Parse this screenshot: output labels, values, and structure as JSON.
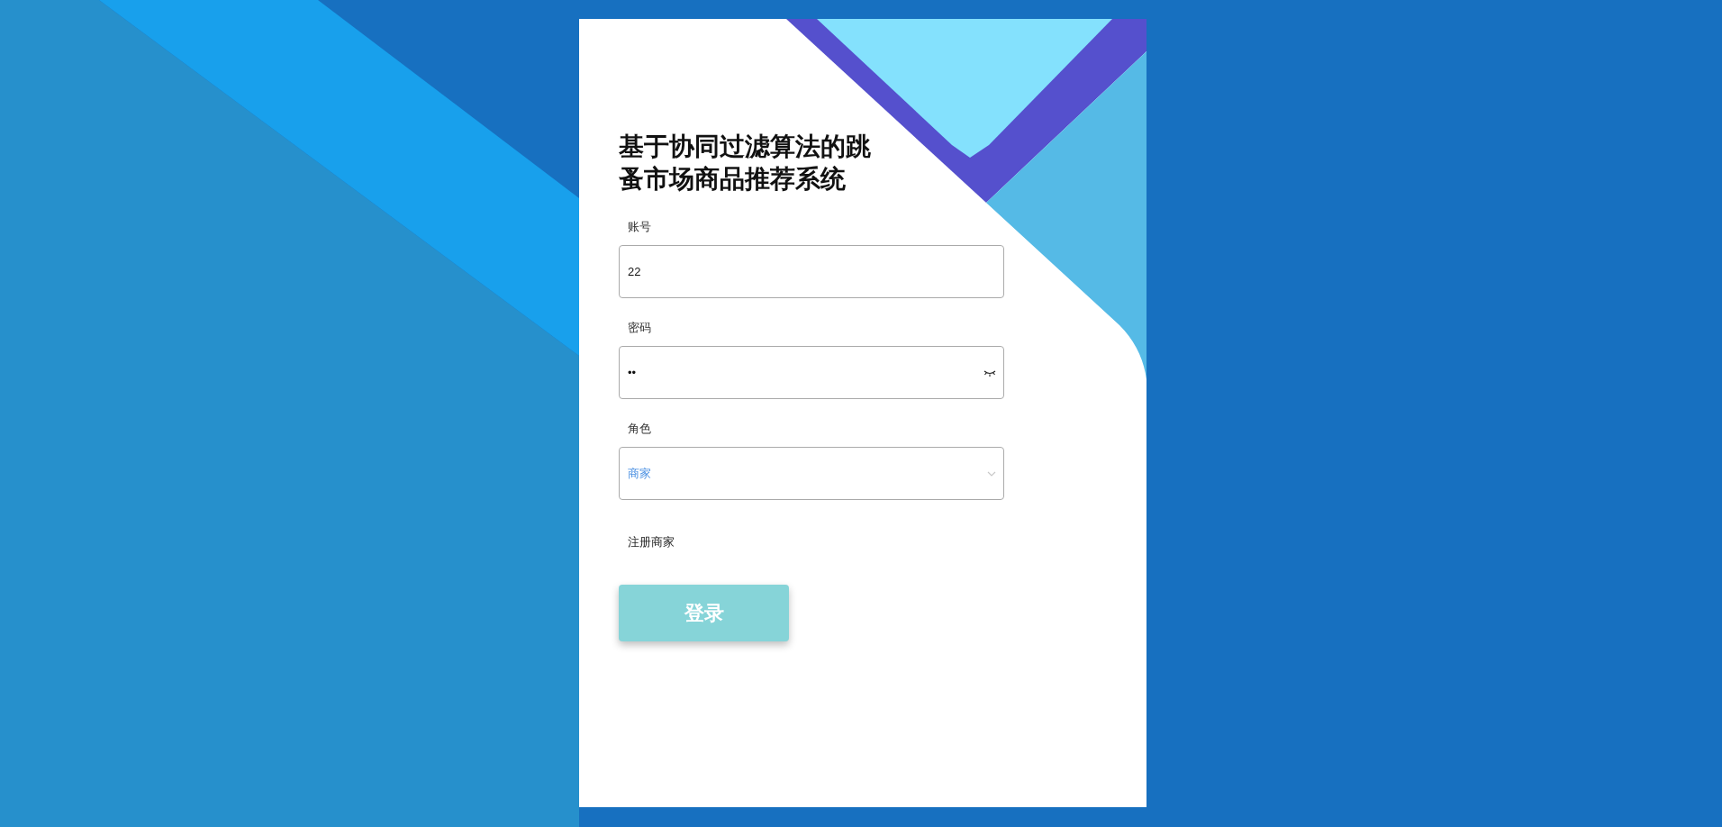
{
  "title": "基于协同过滤算法的跳蚤市场商品推荐系统",
  "fields": [
    {
      "kind": "text",
      "label": "账号",
      "value": "22"
    },
    {
      "kind": "password",
      "label": "密码",
      "value": "••"
    },
    {
      "kind": "select",
      "label": "角色",
      "value": "商家"
    }
  ],
  "register_link": "注册商家",
  "login_button": "登录"
}
